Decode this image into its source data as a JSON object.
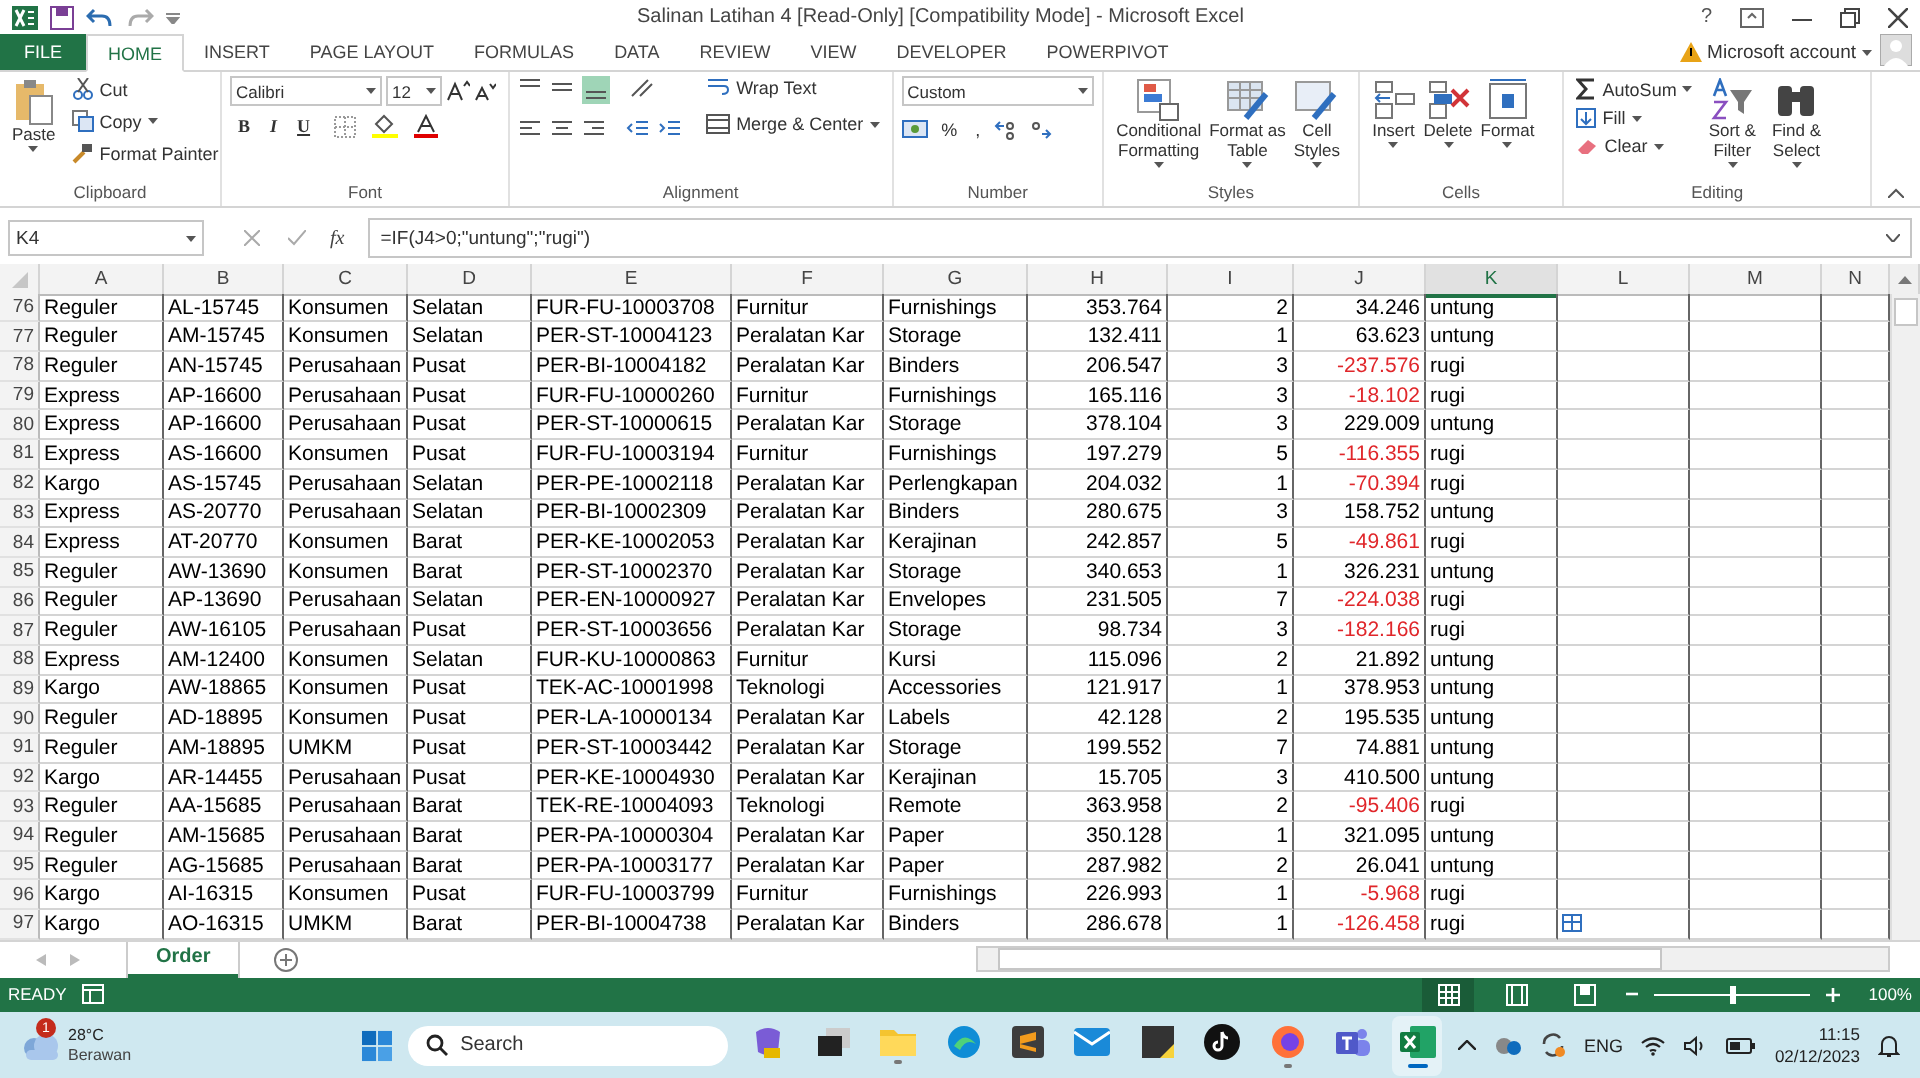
{
  "title_bar": {
    "title": "Salinan Latihan 4  [Read-Only]  [Compatibility Mode] - Microsoft Excel",
    "help": "?"
  },
  "tabs": [
    {
      "label": "FILE",
      "kind": "file",
      "selected": false
    },
    {
      "label": "HOME",
      "kind": "tab",
      "selected": true
    },
    {
      "label": "INSERT",
      "kind": "tab",
      "selected": false
    },
    {
      "label": "PAGE LAYOUT",
      "kind": "tab",
      "selected": false
    },
    {
      "label": "FORMULAS",
      "kind": "tab",
      "selected": false
    },
    {
      "label": "DATA",
      "kind": "tab",
      "selected": false
    },
    {
      "label": "REVIEW",
      "kind": "tab",
      "selected": false
    },
    {
      "label": "VIEW",
      "kind": "tab",
      "selected": false
    },
    {
      "label": "DEVELOPER",
      "kind": "tab",
      "selected": false
    },
    {
      "label": "POWERPIVOT",
      "kind": "tab",
      "selected": false
    }
  ],
  "account": {
    "label": "Microsoft account"
  },
  "ribbon": {
    "clipboard": {
      "label": "Clipboard",
      "paste": "Paste",
      "items": [
        "Cut",
        "Copy",
        "Format Painter"
      ]
    },
    "font": {
      "label": "Font",
      "name": "Calibri",
      "size": "12",
      "styles": [
        "B",
        "I",
        "U"
      ]
    },
    "alignment": {
      "label": "Alignment",
      "wrap": "Wrap Text",
      "merge": "Merge & Center"
    },
    "number": {
      "label": "Number",
      "format": "Custom",
      "symbols": [
        "%",
        ","
      ]
    },
    "styles": {
      "label": "Styles",
      "buttons": [
        "Conditional\nFormatting",
        "Format as\nTable",
        "Cell\nStyles"
      ]
    },
    "cells": {
      "label": "Cells",
      "buttons": [
        "Insert",
        "Delete",
        "Format"
      ]
    },
    "editing": {
      "label": "Editing",
      "items": [
        "AutoSum",
        "Fill",
        "Clear"
      ],
      "buttons": [
        "Sort &\nFilter",
        "Find &\nSelect"
      ]
    }
  },
  "formula_bar": {
    "name_box": "K4",
    "fx": "fx",
    "formula": "=IF(J4>0;\"untung\";\"rugi\")"
  },
  "columns": [
    {
      "label": "A",
      "selected": false
    },
    {
      "label": "B",
      "selected": false
    },
    {
      "label": "C",
      "selected": false
    },
    {
      "label": "D",
      "selected": false
    },
    {
      "label": "E",
      "selected": false
    },
    {
      "label": "F",
      "selected": false
    },
    {
      "label": "G",
      "selected": false
    },
    {
      "label": "H",
      "selected": false
    },
    {
      "label": "I",
      "selected": false
    },
    {
      "label": "J",
      "selected": false
    },
    {
      "label": "K",
      "selected": true
    },
    {
      "label": "L",
      "selected": false
    },
    {
      "label": "M",
      "selected": false
    },
    {
      "label": "N",
      "selected": false
    }
  ],
  "rows": [
    {
      "num": "76",
      "cells": [
        "Reguler",
        "AL-15745",
        "Konsumen",
        "Selatan",
        "FUR-FU-10003708",
        "Furnitur",
        "Furnishings",
        "353.764",
        "2",
        "34.246",
        "untung"
      ],
      "loss": false
    },
    {
      "num": "77",
      "cells": [
        "Reguler",
        "AM-15745",
        "Konsumen",
        "Selatan",
        "PER-ST-10004123",
        "Peralatan Kar",
        "Storage",
        "132.411",
        "1",
        "63.623",
        "untung"
      ],
      "loss": false
    },
    {
      "num": "78",
      "cells": [
        "Reguler",
        "AN-15745",
        "Perusahaan",
        "Pusat",
        "PER-BI-10004182",
        "Peralatan Kar",
        "Binders",
        "206.547",
        "3",
        "-237.576",
        "rugi"
      ],
      "loss": true
    },
    {
      "num": "79",
      "cells": [
        "Express",
        "AP-16600",
        "Perusahaan",
        "Pusat",
        "FUR-FU-10000260",
        "Furnitur",
        "Furnishings",
        "165.116",
        "3",
        "-18.102",
        "rugi"
      ],
      "loss": true
    },
    {
      "num": "80",
      "cells": [
        "Express",
        "AP-16600",
        "Perusahaan",
        "Pusat",
        "PER-ST-10000615",
        "Peralatan Kar",
        "Storage",
        "378.104",
        "3",
        "229.009",
        "untung"
      ],
      "loss": false
    },
    {
      "num": "81",
      "cells": [
        "Express",
        "AS-16600",
        "Konsumen",
        "Pusat",
        "FUR-FU-10003194",
        "Furnitur",
        "Furnishings",
        "197.279",
        "5",
        "-116.355",
        "rugi"
      ],
      "loss": true
    },
    {
      "num": "82",
      "cells": [
        "Kargo",
        "AS-15745",
        "Perusahaan",
        "Selatan",
        "PER-PE-10002118",
        "Peralatan Kar",
        "Perlengkapan",
        "204.032",
        "1",
        "-70.394",
        "rugi"
      ],
      "loss": true
    },
    {
      "num": "83",
      "cells": [
        "Express",
        "AS-20770",
        "Perusahaan",
        "Selatan",
        "PER-BI-10002309",
        "Peralatan Kar",
        "Binders",
        "280.675",
        "3",
        "158.752",
        "untung"
      ],
      "loss": false
    },
    {
      "num": "84",
      "cells": [
        "Express",
        "AT-20770",
        "Konsumen",
        "Barat",
        "PER-KE-10002053",
        "Peralatan Kar",
        "Kerajinan",
        "242.857",
        "5",
        "-49.861",
        "rugi"
      ],
      "loss": true
    },
    {
      "num": "85",
      "cells": [
        "Reguler",
        "AW-13690",
        "Konsumen",
        "Barat",
        "PER-ST-10002370",
        "Peralatan Kar",
        "Storage",
        "340.653",
        "1",
        "326.231",
        "untung"
      ],
      "loss": false
    },
    {
      "num": "86",
      "cells": [
        "Reguler",
        "AP-13690",
        "Perusahaan",
        "Selatan",
        "PER-EN-10000927",
        "Peralatan Kar",
        "Envelopes",
        "231.505",
        "7",
        "-224.038",
        "rugi"
      ],
      "loss": true
    },
    {
      "num": "87",
      "cells": [
        "Reguler",
        "AW-16105",
        "Perusahaan",
        "Pusat",
        "PER-ST-10003656",
        "Peralatan Kar",
        "Storage",
        "98.734",
        "3",
        "-182.166",
        "rugi"
      ],
      "loss": true
    },
    {
      "num": "88",
      "cells": [
        "Express",
        "AM-12400",
        "Konsumen",
        "Selatan",
        "FUR-KU-10000863",
        "Furnitur",
        "Kursi",
        "115.096",
        "2",
        "21.892",
        "untung"
      ],
      "loss": false
    },
    {
      "num": "89",
      "cells": [
        "Kargo",
        "AW-18865",
        "Konsumen",
        "Pusat",
        "TEK-AC-10001998",
        "Teknologi",
        "Accessories",
        "121.917",
        "1",
        "378.953",
        "untung"
      ],
      "loss": false
    },
    {
      "num": "90",
      "cells": [
        "Reguler",
        "AD-18895",
        "Konsumen",
        "Pusat",
        "PER-LA-10000134",
        "Peralatan Kar",
        "Labels",
        "42.128",
        "2",
        "195.535",
        "untung"
      ],
      "loss": false
    },
    {
      "num": "91",
      "cells": [
        "Reguler",
        "AM-18895",
        "UMKM",
        "Pusat",
        "PER-ST-10003442",
        "Peralatan Kar",
        "Storage",
        "199.552",
        "7",
        "74.881",
        "untung"
      ],
      "loss": false
    },
    {
      "num": "92",
      "cells": [
        "Kargo",
        "AR-14455",
        "Perusahaan",
        "Pusat",
        "PER-KE-10004930",
        "Peralatan Kar",
        "Kerajinan",
        "15.705",
        "3",
        "410.500",
        "untung"
      ],
      "loss": false
    },
    {
      "num": "93",
      "cells": [
        "Reguler",
        "AA-15685",
        "Perusahaan",
        "Barat",
        "TEK-RE-10004093",
        "Teknologi",
        "Remote",
        "363.958",
        "2",
        "-95.406",
        "rugi"
      ],
      "loss": true
    },
    {
      "num": "94",
      "cells": [
        "Reguler",
        "AM-15685",
        "Perusahaan",
        "Barat",
        "PER-PA-10000304",
        "Peralatan Kar",
        "Paper",
        "350.128",
        "1",
        "321.095",
        "untung"
      ],
      "loss": false
    },
    {
      "num": "95",
      "cells": [
        "Reguler",
        "AG-15685",
        "Perusahaan",
        "Barat",
        "PER-PA-10003177",
        "Peralatan Kar",
        "Paper",
        "287.982",
        "2",
        "26.041",
        "untung"
      ],
      "loss": false
    },
    {
      "num": "96",
      "cells": [
        "Kargo",
        "AI-16315",
        "Konsumen",
        "Pusat",
        "FUR-FU-10003799",
        "Furnitur",
        "Furnishings",
        "226.993",
        "1",
        "-5.968",
        "rugi"
      ],
      "loss": true
    },
    {
      "num": "97",
      "cells": [
        "Kargo",
        "AO-16315",
        "UMKM",
        "Barat",
        "PER-BI-10004738",
        "Peralatan Kar",
        "Binders",
        "286.678",
        "1",
        "-126.458",
        "rugi"
      ],
      "loss": true
    }
  ],
  "sheet_tabs": [
    {
      "label": "Order",
      "selected": true
    }
  ],
  "status_bar": {
    "status": "READY",
    "views": [
      {
        "kind": "normal",
        "selected": true
      },
      {
        "kind": "layout",
        "selected": false
      },
      {
        "kind": "break",
        "selected": false
      }
    ],
    "level": 0.5,
    "zoom": "100%"
  },
  "taskbar": {
    "weather": {
      "badge": "1",
      "temp": "28°C",
      "condition": "Berawan"
    },
    "search": {
      "placeholder": "Search"
    },
    "apps": [
      {
        "kind": "copilot",
        "running": false,
        "selected": false
      },
      {
        "kind": "taskview",
        "running": false,
        "selected": false
      },
      {
        "kind": "explorer",
        "running": true,
        "selected": false
      },
      {
        "kind": "edge",
        "running": false,
        "selected": false
      },
      {
        "kind": "sublime",
        "running": false,
        "selected": false
      },
      {
        "kind": "mail",
        "running": false,
        "selected": false
      },
      {
        "kind": "notes",
        "running": false,
        "selected": false
      },
      {
        "kind": "tiktok",
        "running": false,
        "selected": false
      },
      {
        "kind": "firefox",
        "running": true,
        "selected": false
      },
      {
        "kind": "teams",
        "running": false,
        "selected": false
      },
      {
        "kind": "excel",
        "running": true,
        "selected": true
      }
    ],
    "language": "ENG",
    "time": "11:15",
    "date": "02/12/2023"
  }
}
